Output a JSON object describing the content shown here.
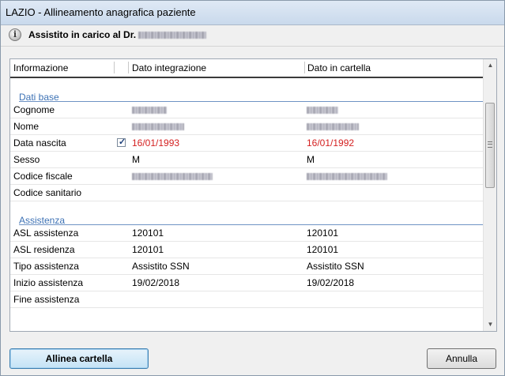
{
  "window": {
    "title": "LAZIO - Allineamento anagrafica paziente"
  },
  "header": {
    "label": "Assistito in carico al Dr."
  },
  "table": {
    "columns": [
      "Informazione",
      "Dato integrazione",
      "Dato in cartella"
    ],
    "sections": [
      {
        "title": "Dati base",
        "rows": [
          {
            "label": "Cognome",
            "integrazione": "",
            "cartella": ""
          },
          {
            "label": "Nome",
            "integrazione": "",
            "cartella": ""
          },
          {
            "label": "Data nascita",
            "integrazione": "16/01/1993",
            "cartella": "16/01/1992",
            "checked": true
          },
          {
            "label": "Sesso",
            "integrazione": "M",
            "cartella": "M"
          },
          {
            "label": "Codice fiscale",
            "integrazione": "",
            "cartella": ""
          },
          {
            "label": "Codice sanitario",
            "integrazione": "",
            "cartella": ""
          }
        ]
      },
      {
        "title": "Assistenza",
        "rows": [
          {
            "label": "ASL assistenza",
            "integrazione": "120101",
            "cartella": "120101"
          },
          {
            "label": "ASL residenza",
            "integrazione": "120101",
            "cartella": "120101"
          },
          {
            "label": "Tipo assistenza",
            "integrazione": "Assistito SSN",
            "cartella": "Assistito SSN"
          },
          {
            "label": "Inizio assistenza",
            "integrazione": "19/02/2018",
            "cartella": "19/02/2018"
          },
          {
            "label": "Fine assistenza",
            "integrazione": "",
            "cartella": ""
          }
        ]
      }
    ]
  },
  "buttons": {
    "align": "Allinea cartella",
    "cancel": "Annulla"
  },
  "colors": {
    "section_title": "#3d72b5",
    "mismatch": "#d41f1f"
  },
  "icons": {
    "header": "info-icon",
    "checkbox": "checkmark-icon"
  }
}
